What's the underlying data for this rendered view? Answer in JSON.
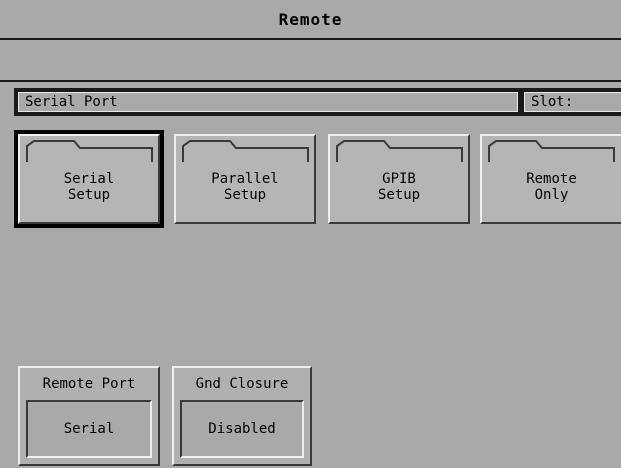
{
  "window": {
    "title": "Remote"
  },
  "port_bar": {
    "name": "Serial Port",
    "slot_label": "Slot:"
  },
  "tabs": [
    {
      "label": "Serial\nSetup",
      "selected": true
    },
    {
      "label": "Parallel\nSetup",
      "selected": false
    },
    {
      "label": "GPIB\nSetup",
      "selected": false
    },
    {
      "label": "Remote\nOnly",
      "selected": false
    }
  ],
  "status": {
    "remote_port": {
      "caption": "Remote Port",
      "value": "Serial"
    },
    "gnd_closure": {
      "caption": "Gnd Closure",
      "value": "Disabled"
    }
  }
}
